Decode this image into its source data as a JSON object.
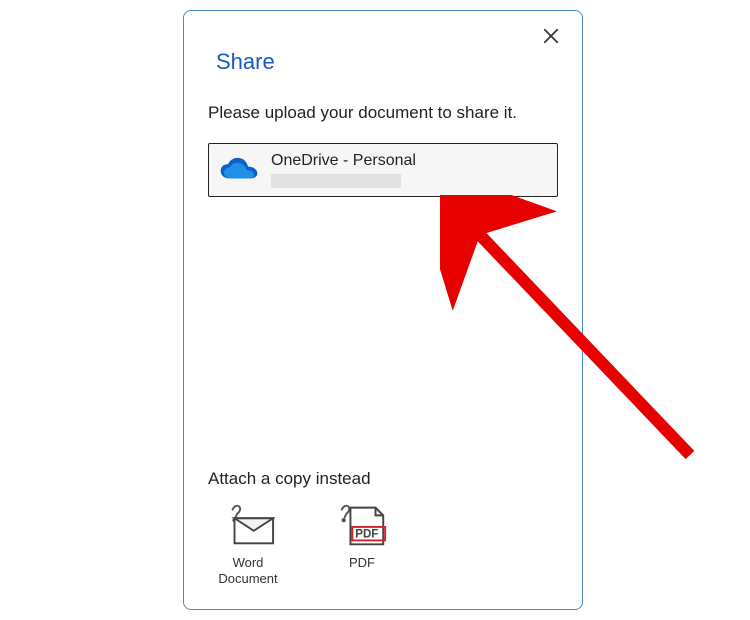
{
  "dialog": {
    "title": "Share",
    "instruction": "Please upload your document to share it.",
    "location": {
      "name": "OneDrive - Personal"
    },
    "attach": {
      "heading": "Attach a copy instead",
      "word_label": "Word Document",
      "pdf_label": "PDF"
    }
  }
}
